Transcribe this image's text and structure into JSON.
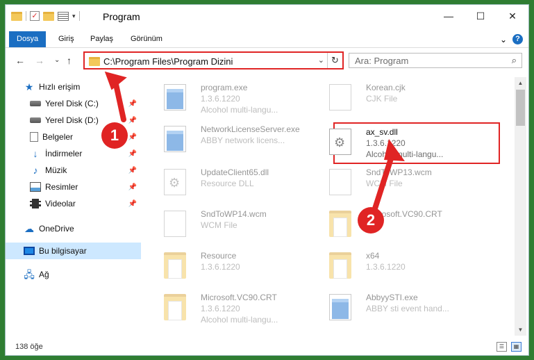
{
  "window": {
    "title": "Program",
    "controls": {
      "minimize": "—",
      "maximize": "☐",
      "close": "✕"
    }
  },
  "qat": {
    "check_glyph": "✓",
    "dropdown_glyph": "▾"
  },
  "ribbon": {
    "tabs": [
      "Dosya",
      "Giriş",
      "Paylaş",
      "Görünüm"
    ],
    "expand_glyph": "⌄",
    "help_glyph": "?"
  },
  "nav": {
    "back": "←",
    "forward": "→",
    "recent": "⌄",
    "up": "↑",
    "address": "C:\\Program Files\\Program Dizini",
    "address_dropdown": "⌄",
    "refresh": "↻",
    "search_placeholder": "Ara: Program",
    "search_glyph": "⌕"
  },
  "sidebar": {
    "pin_glyph": "📌",
    "quick_access": {
      "label": "Hızlı erişim",
      "icon": "star-icon",
      "glyph": "★"
    },
    "items": [
      {
        "label": "Yerel Disk (C:)",
        "icon": "drive-icon",
        "pinned": true
      },
      {
        "label": "Yerel Disk (D:)",
        "icon": "drive-icon",
        "pinned": true
      },
      {
        "label": "Belgeler",
        "icon": "documents-icon",
        "pinned": true
      },
      {
        "label": "İndirmeler",
        "icon": "download-icon",
        "glyph": "↓",
        "pinned": true
      },
      {
        "label": "Müzik",
        "icon": "music-icon",
        "glyph": "♪",
        "pinned": true
      },
      {
        "label": "Resimler",
        "icon": "pictures-icon",
        "pinned": true
      },
      {
        "label": "Videolar",
        "icon": "videos-icon",
        "pinned": true
      }
    ],
    "onedrive": {
      "label": "OneDrive",
      "icon": "cloud-icon",
      "glyph": "☁"
    },
    "this_pc": {
      "label": "Bu bilgisayar",
      "icon": "computer-icon"
    },
    "network": {
      "label": "Ağ",
      "icon": "network-icon",
      "glyph": "🖧"
    }
  },
  "files": [
    {
      "name": "program.exe",
      "line2": "1.3.6.1220",
      "line3": "Alcohol multi-langu...",
      "icon": "exe-icon",
      "faded": true
    },
    {
      "name": "Korean.cjk",
      "line2": "CJK File",
      "line3": "",
      "icon": "document-icon",
      "faded": true
    },
    {
      "name": "NetworkLicenseServer.exe",
      "line2": "ABBY network licens...",
      "line3": "",
      "icon": "exe-icon",
      "faded": true
    },
    {
      "name": "ax_sv.dll",
      "line2": "1.3.6.1220",
      "line3": "Alcohol multi-langu...",
      "icon": "dll-icon",
      "faded": false
    },
    {
      "name": "UpdateClient65.dll",
      "line2": "Resource DLL",
      "line3": "",
      "icon": "dll-icon",
      "faded": true
    },
    {
      "name": "SndToWP13.wcm",
      "line2": "WCM File",
      "line3": "",
      "icon": "document-icon",
      "faded": true
    },
    {
      "name": "SndToWP14.wcm",
      "line2": "WCM File",
      "line3": "",
      "icon": "document-icon",
      "faded": true
    },
    {
      "name": "Microsoft.VC90.CRT",
      "line2": "",
      "line3": "",
      "icon": "folder-icon",
      "faded": true
    },
    {
      "name": "Resource",
      "line2": "1.3.6.1220",
      "line3": "",
      "icon": "folder-icon",
      "faded": true
    },
    {
      "name": "x64",
      "line2": "1.3.6.1220",
      "line3": "",
      "icon": "folder-icon",
      "faded": true
    },
    {
      "name": "Microsoft.VC90.CRT",
      "line2": "1.3.6.1220",
      "line3": "Alcohol multi-langu...",
      "icon": "folder-icon",
      "faded": true
    },
    {
      "name": "AbbyySTI.exe",
      "line2": "ABBY sti event hand...",
      "line3": "",
      "icon": "exe-icon",
      "faded": true
    }
  ],
  "scrollbar": {
    "up": "▲",
    "down": "▼"
  },
  "status": {
    "count": "138 öğe",
    "details_glyph": "☰",
    "tiles_glyph": "▦"
  },
  "annotations": {
    "step1": "1",
    "step2": "2",
    "color": "#e02424"
  }
}
